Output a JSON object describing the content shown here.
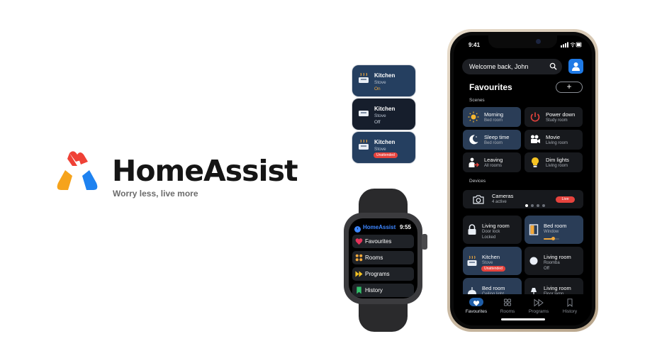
{
  "brand": {
    "name": "HomeAssist",
    "tagline": "Worry less, live more",
    "logo_icon": "home-triangle-logo"
  },
  "widgets": [
    {
      "room": "Kitchen",
      "device": "Stove",
      "status": "On",
      "style": "light",
      "icon": "stove-icon"
    },
    {
      "room": "Kitchen",
      "device": "Stove",
      "status": "Off",
      "style": "dark",
      "icon": "stove-icon"
    },
    {
      "room": "Kitchen",
      "device": "Stove",
      "status": "Unattended",
      "style": "light",
      "icon": "stove-icon",
      "alert": true
    }
  ],
  "watch": {
    "app_title": "HomeAssist",
    "time": "9:55",
    "items": [
      {
        "label": "Favourites",
        "icon": "heart-icon"
      },
      {
        "label": "Rooms",
        "icon": "grid-icon"
      },
      {
        "label": "Programs",
        "icon": "fast-forward-icon"
      },
      {
        "label": "History",
        "icon": "bookmark-icon"
      }
    ]
  },
  "phone": {
    "status_time": "9:41",
    "welcome": "Welcome back, John",
    "title": "Favourites",
    "add_label": "+",
    "scenes_label": "Scenes",
    "scenes": [
      {
        "name": "Morning",
        "sub": "Bed room",
        "icon": "sun-icon",
        "active": true
      },
      {
        "name": "Power down",
        "sub": "Study room",
        "icon": "power-icon",
        "active": false
      },
      {
        "name": "Sleep time",
        "sub": "Bed room",
        "icon": "moon-icon",
        "active": true
      },
      {
        "name": "Movie",
        "sub": "Living room",
        "icon": "movie-camera-icon",
        "active": false
      },
      {
        "name": "Leaving",
        "sub": "All rooms",
        "icon": "leaving-icon",
        "active": false
      },
      {
        "name": "Dim lights",
        "sub": "Living room",
        "icon": "lightbulb-icon",
        "active": false
      }
    ],
    "devices_label": "Devices",
    "cameras": {
      "name": "Cameras",
      "sub": "4 active",
      "live": "Live",
      "icon": "camera-icon"
    },
    "devices": [
      {
        "name": "Living room",
        "l2": "Door lock",
        "l3": "Locked",
        "icon": "lock-icon",
        "active": false
      },
      {
        "name": "Bed room",
        "l2": "Window",
        "icon": "window-icon",
        "active": true,
        "slider": 0.6
      },
      {
        "name": "Kitchen",
        "l2": "Stove",
        "pill": "Unattended",
        "icon": "stove-icon",
        "active": true
      },
      {
        "name": "Living room",
        "l2": "Roomba",
        "l3": "Off",
        "icon": "roomba-icon",
        "active": false
      },
      {
        "name": "Bed room",
        "l2": "Ceiling light",
        "icon": "ceiling-lamp-icon",
        "active": true
      },
      {
        "name": "Living room",
        "l2": "Floor lamp",
        "icon": "floor-lamp-icon",
        "active": false
      }
    ],
    "tabs": [
      {
        "label": "Favourites",
        "icon": "heart-icon",
        "active": true
      },
      {
        "label": "Rooms",
        "icon": "grid-icon",
        "active": false
      },
      {
        "label": "Programs",
        "icon": "fast-forward-icon",
        "active": false
      },
      {
        "label": "History",
        "icon": "bookmark-icon",
        "active": false
      }
    ]
  }
}
